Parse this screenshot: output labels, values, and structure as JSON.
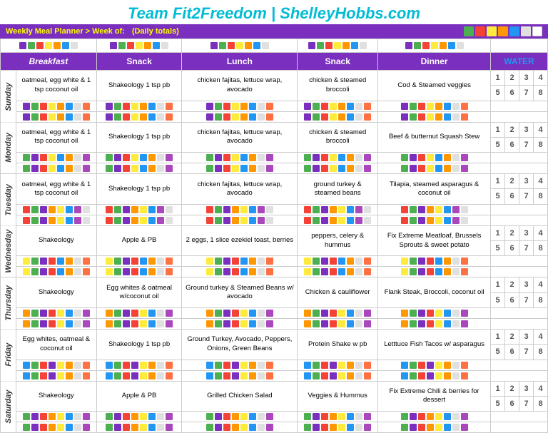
{
  "header": {
    "title": "Team Fit2Freedom | ShelleyHobbs.com",
    "sub": "Weekly Meal Planner > Week of:",
    "daily": "(Daily totals)"
  },
  "columns": {
    "breakfast": "Breakfast",
    "snack1": "Snack",
    "lunch": "Lunch",
    "snack2": "Snack",
    "dinner": "Dinner",
    "water": "WATER"
  },
  "water_nums": [
    1,
    2,
    3,
    4,
    5,
    6,
    7,
    8
  ],
  "days": [
    {
      "day": "Sunday",
      "breakfast": "oatmeal, egg white & 1 tsp coconut oil",
      "snack1": "Shakeology 1 tsp pb",
      "lunch": "chicken fajitas, lettuce wrap, avocado",
      "snack2": "chicken & steamed broccoli",
      "dinner": "Cod & Steamed veggies"
    },
    {
      "day": "Monday",
      "breakfast": "oatmeal, egg white & 1 tsp coconut oil",
      "snack1": "Shakeology 1 tsp pb",
      "lunch": "chicken fajitas, lettuce wrap, avocado",
      "snack2": "chicken & steamed broccoli",
      "dinner": "Beef & butternut Squash Stew"
    },
    {
      "day": "Tuesday",
      "breakfast": "oatmeal, egg white & 1 tsp coconut oil",
      "snack1": "Shakeology 1 tsp pb",
      "lunch": "chicken fajitas, lettuce wrap, avocado",
      "snack2": "ground turkey & steamed beans",
      "dinner": "Tilapia, steamed asparagus & coconut oil"
    },
    {
      "day": "Wednesday",
      "breakfast": "Shakeology",
      "snack1": "Apple & PB",
      "lunch": "2 eggs, 1 slice ezekiel toast, berries",
      "snack2": "peppers, celery & hummus",
      "dinner": "Fix Extreme Meatloaf, Brussels Sprouts & sweet potato"
    },
    {
      "day": "Thursday",
      "breakfast": "Shakeology",
      "snack1": "Egg whites & oatmeal w/coconut oil",
      "lunch": "Ground turkey & Steamed Beans w/ avocado",
      "snack2": "Chicken & cauliflower",
      "dinner": "Flank Steak, Broccoli, coconut oil"
    },
    {
      "day": "Friday",
      "breakfast": "Egg whites, oatmeal & coconut oil",
      "snack1": "Shakeology 1 tsp pb",
      "lunch": "Ground Turkey, Avocado, Peppers, Onions, Green Beans",
      "snack2": "Protein Shake w pb",
      "dinner": "Letttuce Fish Tacos w/ asparagus"
    },
    {
      "day": "Saturday",
      "breakfast": "Shakeology",
      "snack1": "Apple & PB",
      "lunch": "Grilled Chicken Salad",
      "snack2": "Veggies & Hummus",
      "dinner": "Fix Extreme Chili & berries for dessert"
    }
  ],
  "colors": {
    "purple": "#7b2fbe",
    "green": "#4caf50",
    "yellow": "#ffeb3b",
    "red": "#f44336",
    "orange": "#ff9800",
    "blue": "#2196f3",
    "light_blue": "#b3e5fc",
    "gray": "#9e9e9e"
  }
}
